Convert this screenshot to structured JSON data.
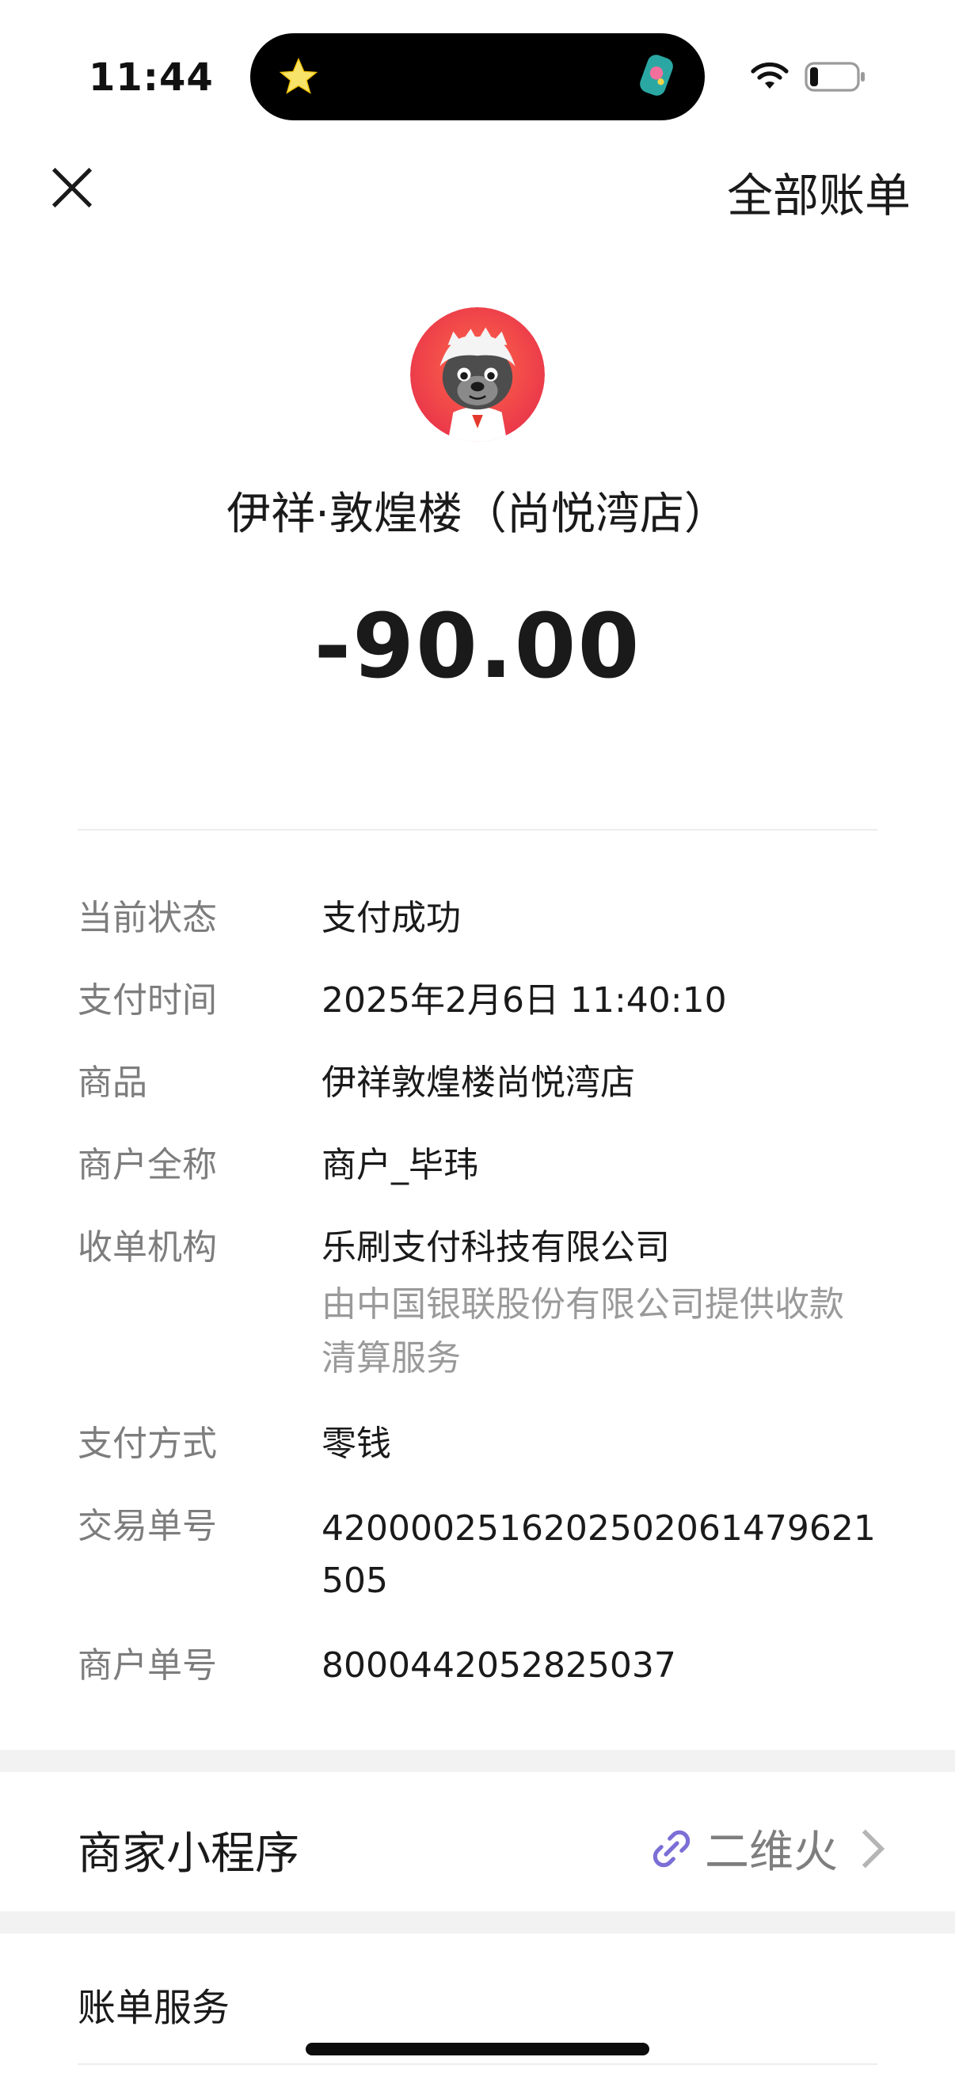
{
  "status_bar": {
    "time": "11:44"
  },
  "header": {
    "right_action": "全部账单"
  },
  "merchant": {
    "name": "伊祥·敦煌楼（尚悦湾店）",
    "amount": "-90.00"
  },
  "details": [
    {
      "label": "当前状态",
      "value": "支付成功"
    },
    {
      "label": "支付时间",
      "value": "2025年2月6日 11:40:10"
    },
    {
      "label": "商品",
      "value": "伊祥敦煌楼尚悦湾店"
    },
    {
      "label": "商户全称",
      "value": "商户_毕玮"
    },
    {
      "label": "收单机构",
      "value": "乐刷支付科技有限公司",
      "note": "由中国银联股份有限公司提供收款清算服务"
    },
    {
      "label": "支付方式",
      "value": "零钱"
    },
    {
      "label": "交易单号",
      "value": "4200002516202502061479621505"
    },
    {
      "label": "商户单号",
      "value": "8000442052825037"
    }
  ],
  "mini_program": {
    "title": "商家小程序",
    "value": "二维火"
  },
  "bill_service": {
    "title": "账单服务"
  },
  "icons": {
    "close": "close-icon",
    "wifi": "wifi-icon",
    "battery": "battery-icon",
    "link": "link-icon",
    "chevron": "chevron-right-icon",
    "avatar": "merchant-avatar"
  },
  "colors": {
    "link_icon": "#7b6fd6",
    "avatar_bg": "#f04e4e"
  }
}
